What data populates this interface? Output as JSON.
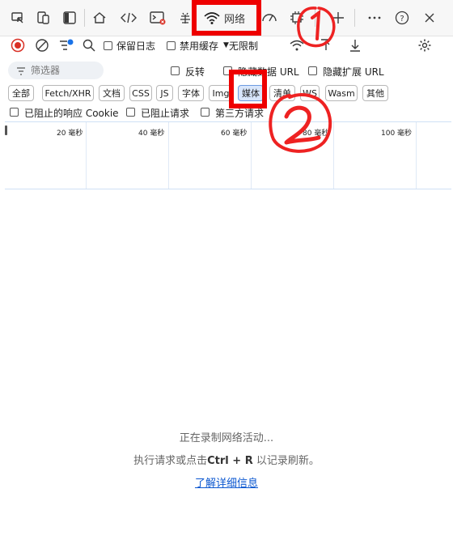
{
  "tabbar": {
    "network_label": "网络",
    "tabs": [
      "device-toggle",
      "device-emulation",
      "sidebar-toggle",
      "home",
      "elements",
      "console",
      "sources",
      "network",
      "performance",
      "memory",
      "add-tab",
      "more",
      "help",
      "close"
    ]
  },
  "toolbar": {
    "preserve_log": "保留日志",
    "disable_cache": "禁用缓存",
    "throttle": "无限制"
  },
  "filter": {
    "placeholder": "筛选器",
    "invert": "反转",
    "hide_data_url": "隐藏数据 URL",
    "hide_ext_url": "隐藏扩展 URL"
  },
  "types": [
    "全部",
    "Fetch/XHR",
    "文档",
    "CSS",
    "JS",
    "字体",
    "Img",
    "媒体",
    "清单",
    "WS",
    "Wasm",
    "其他"
  ],
  "blocked": {
    "blocked_cookies": "已阻止的响应 Cookie",
    "blocked_requests": "已阻止请求",
    "third_party": "第三方请求"
  },
  "timeline": {
    "ticks": [
      "20 毫秒",
      "40 毫秒",
      "60 毫秒",
      "80 毫秒",
      "100 毫秒"
    ]
  },
  "empty": {
    "recording": "正在录制网络活动...",
    "hint_prefix": "执行请求或点击",
    "hint_key": "Ctrl + R",
    "hint_suffix": "以记录刷新。",
    "learn_more": "了解详细信息"
  },
  "annotations": {
    "mark1": "①",
    "mark2": "②"
  },
  "colors": {
    "accent": "#0b57d0",
    "annotation": "#ee0000",
    "record": "#d93025"
  }
}
